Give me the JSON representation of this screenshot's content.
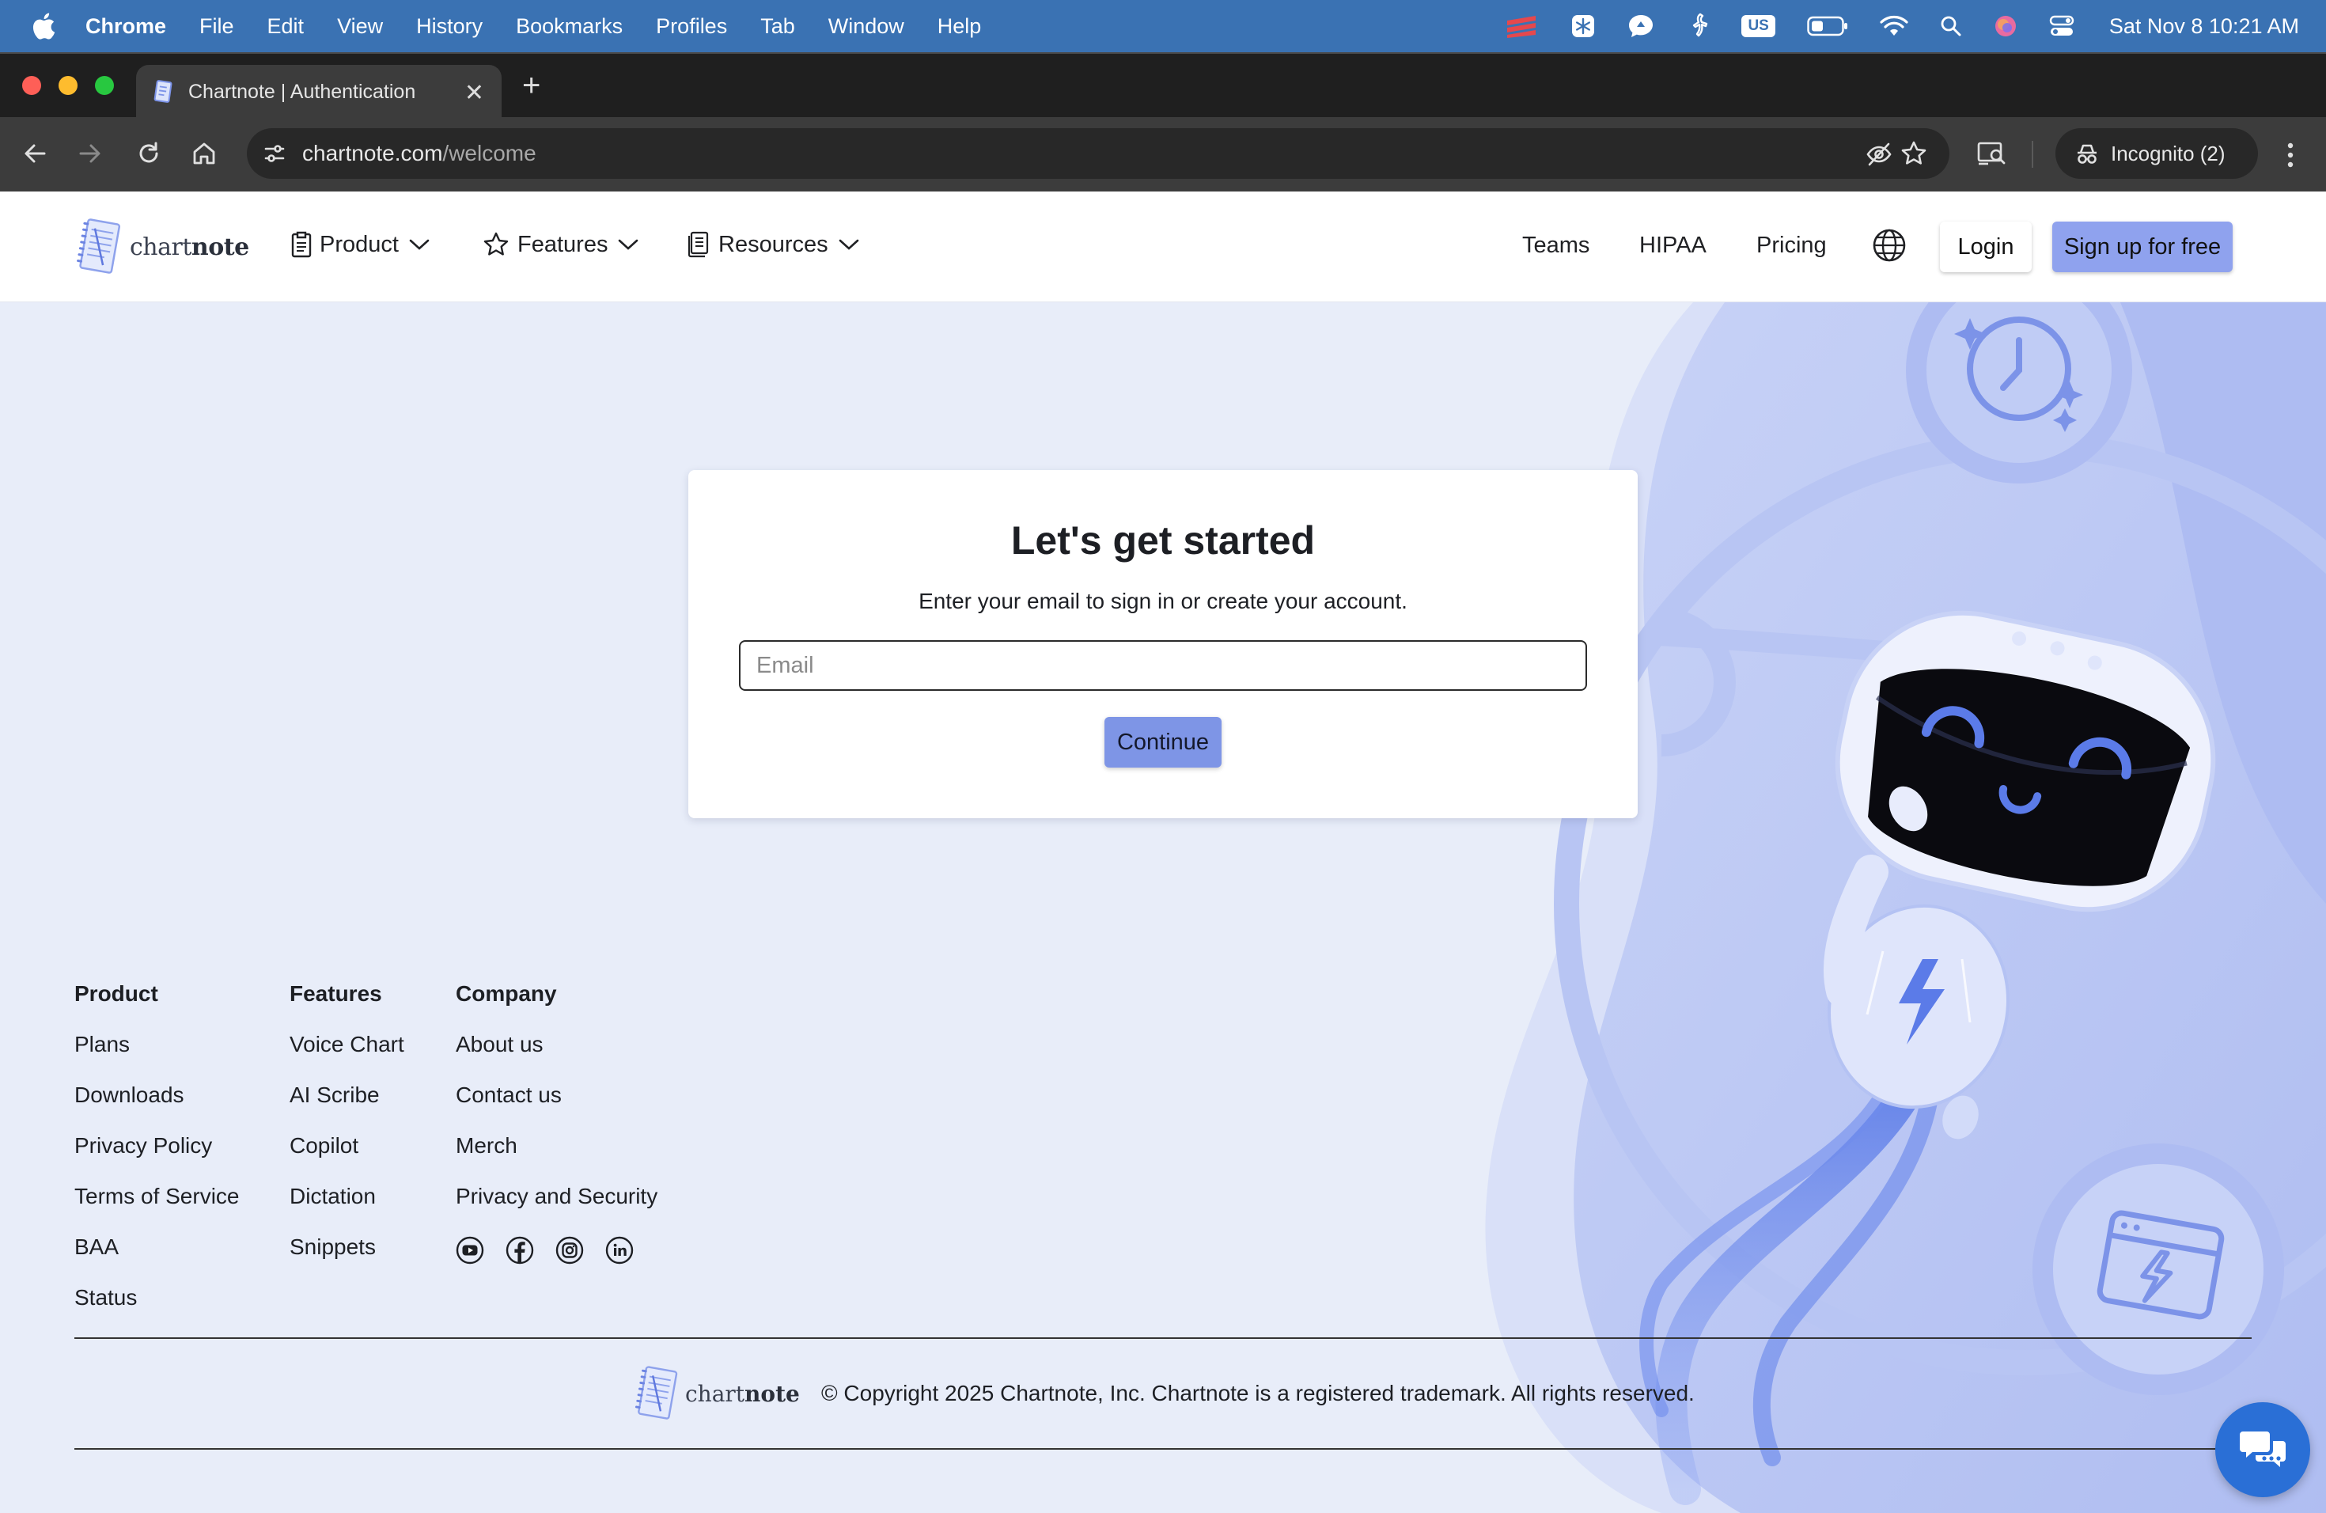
{
  "macos_menubar": {
    "app_name": "Chrome",
    "menus": [
      "File",
      "Edit",
      "View",
      "History",
      "Bookmarks",
      "Profiles",
      "Tab",
      "Window",
      "Help"
    ],
    "input_source": "US",
    "clock": "Sat Nov 8  10:21 AM"
  },
  "browser": {
    "tab_title": "Chartnote | Authentication",
    "url_domain": "chartnote.com",
    "url_path": "/welcome",
    "profile_label": "Incognito (2)"
  },
  "header": {
    "logo_plain": "chart",
    "logo_bold": "note",
    "nav_dropdowns": [
      "Product",
      "Features",
      "Resources"
    ],
    "nav_links": [
      "Teams",
      "HIPAA",
      "Pricing"
    ],
    "login_label": "Login",
    "signup_label": "Sign up for free"
  },
  "card": {
    "title": "Let's get started",
    "subtitle": "Enter your email to sign in or create your account.",
    "email_placeholder": "Email",
    "continue_label": "Continue"
  },
  "footer": {
    "columns": [
      {
        "title": "Product",
        "links": [
          "Plans",
          "Downloads",
          "Privacy Policy",
          "Terms of Service",
          "BAA",
          "Status"
        ]
      },
      {
        "title": "Features",
        "links": [
          "Voice Chart",
          "AI Scribe",
          "Copilot",
          "Dictation",
          "Snippets"
        ]
      },
      {
        "title": "Company",
        "links": [
          "About us",
          "Contact us",
          "Merch",
          "Privacy and Security"
        ]
      }
    ],
    "social_icons": [
      "youtube-icon",
      "facebook-icon",
      "instagram-icon",
      "linkedin-icon"
    ],
    "copyright": "© Copyright 2025 Chartnote, Inc. Chartnote is a registered trademark. All rights reserved."
  },
  "colors": {
    "page_bg": "#e8edf9",
    "accent": "#8fa2ee",
    "continue_button": "#7e95e6",
    "chat_button": "#2a6fd6",
    "macos_menubar": "#3a72b3"
  }
}
